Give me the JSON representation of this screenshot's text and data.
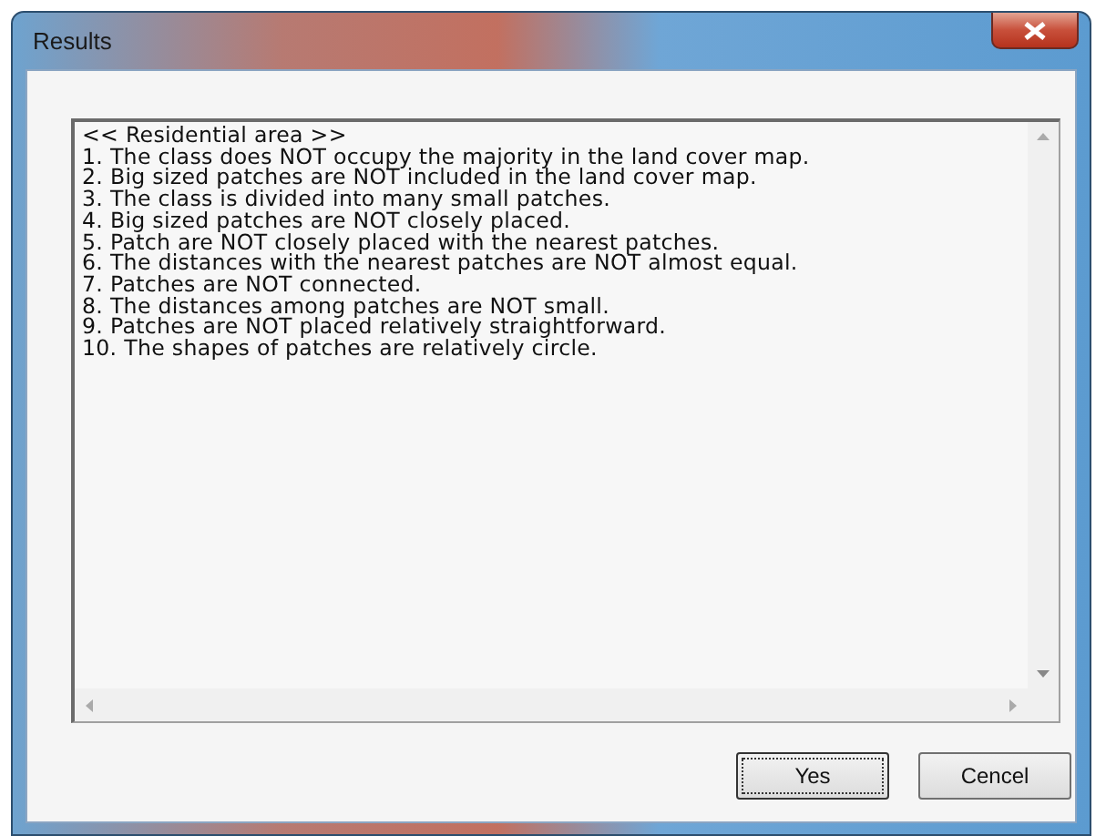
{
  "window": {
    "title": "Results"
  },
  "text_area": {
    "lines": [
      "<< Residential area >>",
      "1. The class does NOT occupy the majority in the land cover map.",
      "2. Big sized patches are NOT included in the land cover map.",
      "3. The class is divided into many small patches.",
      "4. Big sized patches are NOT closely placed.",
      "5. Patch are NOT closely placed with the nearest patches.",
      "6. The distances with the nearest patches are NOT almost equal.",
      "7. Patches are NOT connected.",
      "8. The distances among patches are NOT small.",
      "9. Patches are NOT placed relatively straightforward.",
      "10. The shapes of patches are relatively circle."
    ]
  },
  "buttons": [
    {
      "label": "Yes",
      "focused": true
    },
    {
      "label": "Cencel",
      "focused": false
    }
  ]
}
